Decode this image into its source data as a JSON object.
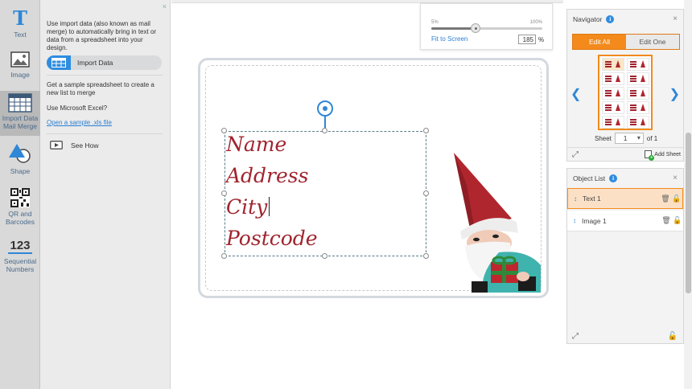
{
  "toolbar": {
    "items": [
      {
        "label": "Text",
        "icon": "text-icon"
      },
      {
        "label": "Image",
        "icon": "image-icon"
      },
      {
        "label": "Import Data Mail Merge",
        "icon": "spreadsheet-icon"
      },
      {
        "label": "Shape",
        "icon": "shape-icon"
      },
      {
        "label": "QR and Barcodes",
        "icon": "qr-code-icon"
      },
      {
        "label": "Sequential Numbers",
        "icon": "sequential-numbers-icon"
      }
    ],
    "numbers_glyph": "123"
  },
  "panel": {
    "close": "×",
    "intro": "Use import data (also known as mail merge) to automatically bring in text or data from a spreadsheet into your design.",
    "import_button": "Import Data",
    "sample_text": "Get a sample spreadsheet to create a new list to merge",
    "excel_question": "Use Microsoft Excel?",
    "sample_link": "Open a sample .xls file",
    "see_how": "See How"
  },
  "zoom": {
    "min_label": "5%",
    "max_label": "100%",
    "fit_label": "Fit to Screen",
    "value": "185",
    "unit": "%",
    "slider_fraction": 0.4
  },
  "label": {
    "lines": [
      "Name",
      "Address",
      "City",
      "Postcode"
    ],
    "text_color": "#a0242f"
  },
  "navigator": {
    "title": "Navigator",
    "close": "×",
    "edit_all": "Edit All",
    "edit_one": "Edit One",
    "sheet_label": "Sheet",
    "sheet_value": "1",
    "sheet_of": "of 1",
    "add_sheet": "Add Sheet",
    "accent": "#f38a1b"
  },
  "objects": {
    "title": "Object List",
    "close": "×",
    "items": [
      {
        "name": "Text 1",
        "active": true
      },
      {
        "name": "Image 1",
        "active": false
      }
    ]
  }
}
